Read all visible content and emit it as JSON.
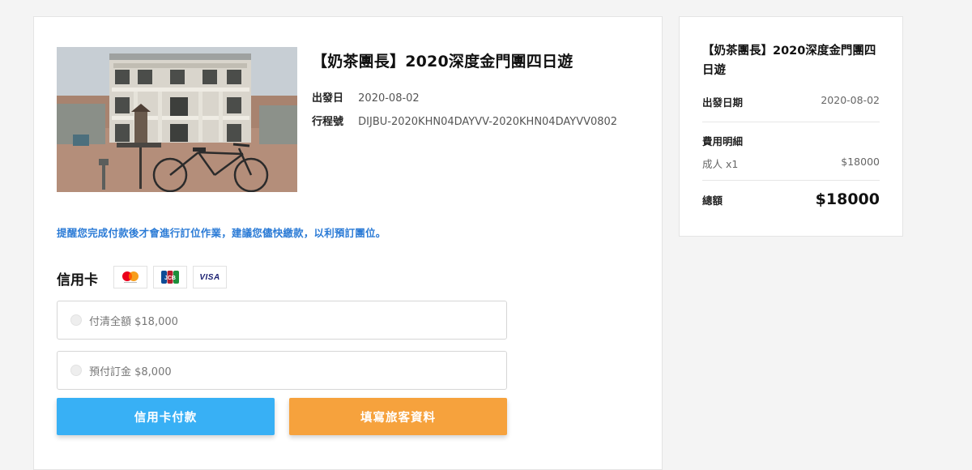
{
  "tour": {
    "title": "【奶茶團長】2020深度金門團四日遊",
    "departure_label": "出發日",
    "departure_value": "2020-08-02",
    "itinerary_label": "行程號",
    "itinerary_value": "DIJBU-2020KHN04DAYVV-2020KHN04DAYVV0802"
  },
  "reminder": "提醒您完成付款後才會進行訂位作業，建議您儘快繳款，以利預訂團位。",
  "payment": {
    "heading": "信用卡",
    "card_logos": [
      "mastercard-icon",
      "jcb-icon",
      "visa-icon"
    ],
    "visa_text": "VISA",
    "jcb_text": "JCB",
    "options": [
      {
        "label": "付清全額 $18,000"
      },
      {
        "label": "預付訂金 $8,000"
      }
    ],
    "pay_button": "信用卡付款",
    "fill_button": "填寫旅客資料"
  },
  "summary": {
    "title": "【奶茶團長】2020深度金門團四日遊",
    "departure_label": "出發日期",
    "departure_value": "2020-08-02",
    "fee_heading": "費用明細",
    "adult_label": "成人 x1",
    "adult_value": "$18000",
    "total_label": "總額",
    "total_value": "$18000"
  },
  "colors": {
    "accent_blue": "#38b0f5",
    "accent_orange": "#f6a23d",
    "reminder_blue": "#2b7bd6"
  }
}
